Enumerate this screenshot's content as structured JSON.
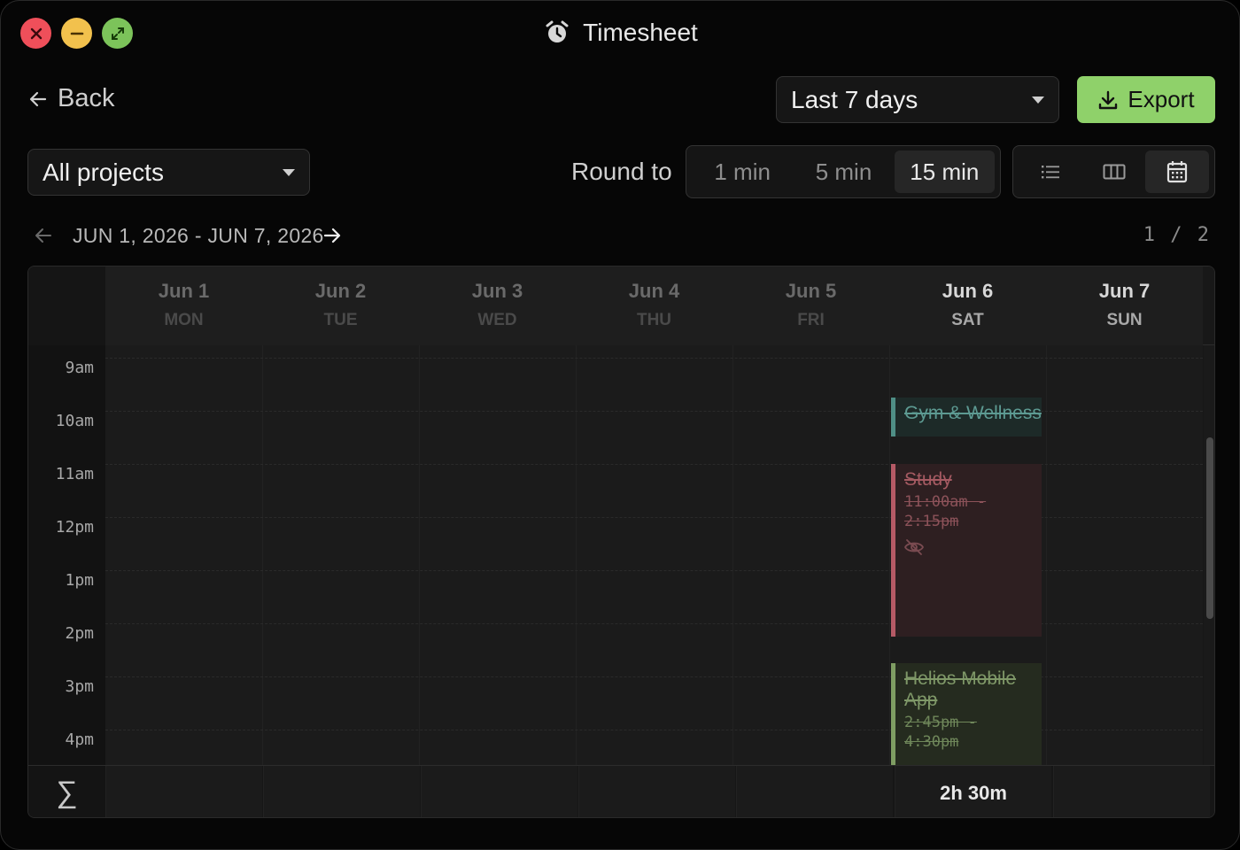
{
  "window": {
    "title": "Timesheet",
    "icons": {
      "close": "close-icon",
      "minimize": "minimize-icon",
      "maximize": "expand-icon",
      "app": "alarm-clock-icon"
    }
  },
  "toolbar": {
    "back_label": "Back",
    "date_range_select": "Last 7 days",
    "export_label": "Export",
    "project_select": "All projects",
    "round_to_label": "Round to",
    "round_options": [
      "1 min",
      "5 min",
      "15 min"
    ],
    "round_selected": "15 min",
    "view_modes": [
      "list-icon",
      "columns-icon",
      "calendar-icon"
    ],
    "view_selected": "calendar-icon",
    "accent_color": "#8fd16a"
  },
  "date_nav": {
    "range_text": "JUN 1, 2026 - JUN 7, 2026",
    "page_current": "1",
    "page_separator": "/",
    "page_total": "2"
  },
  "calendar": {
    "days": [
      {
        "date": "Jun 1",
        "weekday": "MON"
      },
      {
        "date": "Jun 2",
        "weekday": "TUE"
      },
      {
        "date": "Jun 3",
        "weekday": "WED"
      },
      {
        "date": "Jun 4",
        "weekday": "THU"
      },
      {
        "date": "Jun 5",
        "weekday": "FRI"
      },
      {
        "date": "Jun 6",
        "weekday": "SAT"
      },
      {
        "date": "Jun 7",
        "weekday": "SUN"
      }
    ],
    "hours": [
      "9am",
      "10am",
      "11am",
      "12pm",
      "1pm",
      "2pm",
      "3pm",
      "4pm"
    ],
    "events": [
      {
        "title": "Gym & Wellness",
        "day": "Jun 6",
        "color": "#4f8f86"
      },
      {
        "title": "Study",
        "day": "Jun 6",
        "time_start": "11:00am -",
        "time_end": "2:15pm",
        "color": "#b65a66",
        "icon": "eye-off-icon"
      },
      {
        "title": "Helios Mobile App",
        "day": "Jun 6",
        "time_start": "2:45pm -",
        "time_end": "4:30pm",
        "color": "#7f9e63"
      }
    ],
    "totals": {
      "sum_symbol": "∑",
      "values": [
        "",
        "",
        "",
        "",
        "",
        "2h 30m",
        ""
      ]
    }
  }
}
